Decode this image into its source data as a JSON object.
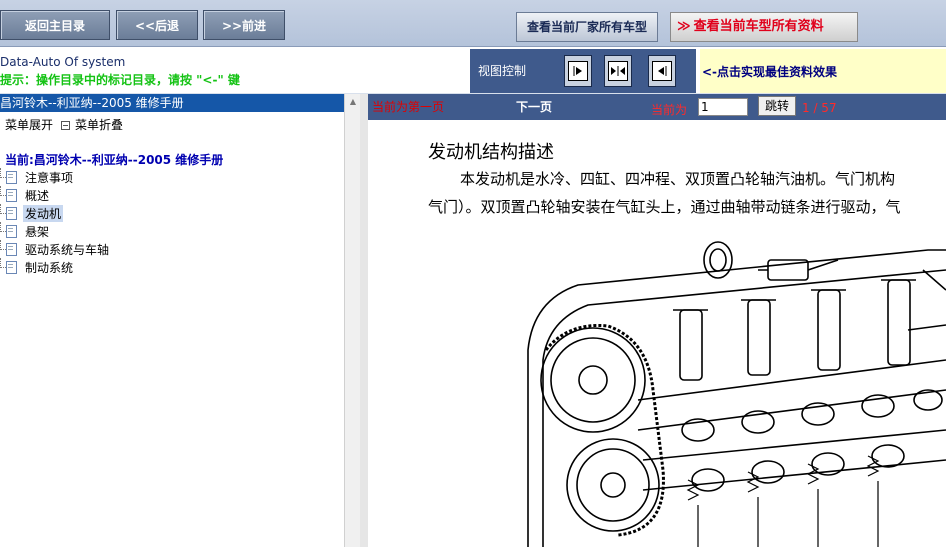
{
  "topbar": {
    "home_label": "返回主目录",
    "back_label": "<<后退",
    "forward_label": ">>前进",
    "vendor_models_label": "查看当前厂家所有车型",
    "model_data_label": "查看当前车型所有资料",
    "model_data_arrow": "≫"
  },
  "infobar": {
    "brand": "Data-Auto Of system",
    "hint": "提示：操作目录中的标记目录，请按 \"<-\" 键",
    "view_control_label": "视图控制",
    "view_buttons": [
      "expand-right",
      "collapse-center",
      "collapse-left"
    ],
    "best_view_hint": "<-点击实现最佳资料效果"
  },
  "sidebar": {
    "book_title": "昌河铃木--利亚纳--2005 维修手册",
    "expand_label": "菜单展开",
    "collapse_label": "菜单折叠",
    "current_label": "当前:昌河铃木--利亚纳--2005 维修手册",
    "items": [
      {
        "label": "注意事项"
      },
      {
        "label": "概述"
      },
      {
        "label": "发动机",
        "selected": true
      },
      {
        "label": "悬架"
      },
      {
        "label": "驱动系统与车轴"
      },
      {
        "label": "制动系统"
      }
    ]
  },
  "docnav": {
    "prev_label": "当前为第一页",
    "next_label": "下一页",
    "current_label": "当前为",
    "page_value": "1",
    "jump_label": "跳转",
    "count": "1 / 57"
  },
  "document": {
    "title": "发动机结构描述",
    "para1": "本发动机是水冷、四缸、四冲程、双顶置凸轮轴汽油机。气门机构",
    "para2": "气门）。双顶置凸轮轴安装在气缸头上，通过曲轴带动链条进行驱动，气"
  },
  "colors": {
    "accent": "#3f5a8c",
    "selection": "#1557a8",
    "hint_green": "#15c315",
    "alert_red": "#e0001b"
  }
}
